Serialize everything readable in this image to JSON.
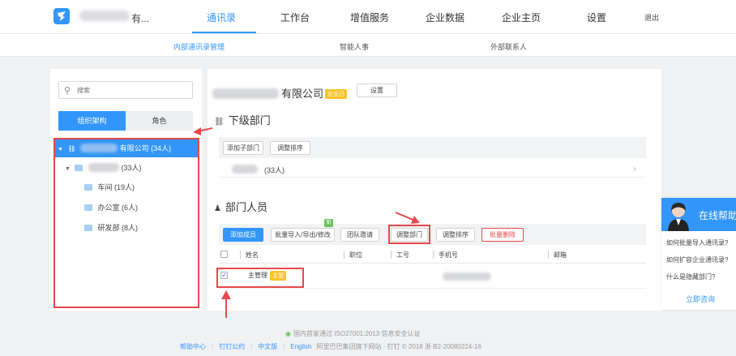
{
  "topnav": {
    "company_suffix": "有...",
    "items": [
      "通讯录",
      "工作台",
      "增值服务",
      "企业数据",
      "企业主页",
      "设置"
    ],
    "logout": "退出"
  },
  "subnav": {
    "items": [
      "内部通讯录管理",
      "智能人事",
      "外部联系人"
    ]
  },
  "sidebar": {
    "search_placeholder": "搜索",
    "tabs": [
      "组织架构",
      "角色"
    ],
    "tree": {
      "root_label": "有限公司 (34人)",
      "dept_count": "(33人)",
      "children": [
        "车间 (19人)",
        "办公室 (6人)",
        "研发部 (8人)"
      ]
    }
  },
  "main": {
    "org_name_suffix": "有限公司",
    "cert_badge": "企业已",
    "settings_button": "设置",
    "sub_dept_title": "下级部门",
    "add_sub_dept": "添加子部门",
    "adjust_order": "调整排序",
    "sub_dept_count": "(33人)",
    "members_title": "部门人员",
    "buttons": {
      "add_member": "添加成员",
      "batch_import": "批量导入/导出/修改",
      "new_badge": "新",
      "team_invite": "团队邀请",
      "adjust_dept": "调整部门",
      "adjust_order": "调整排序",
      "batch_delete": "批量删除"
    },
    "table_headers": [
      "姓名",
      "职位",
      "工号",
      "手机号",
      "邮箱"
    ],
    "rows": [
      {
        "name": "主管理",
        "badge": "主管"
      }
    ]
  },
  "help": {
    "title": "在线帮助",
    "questions": [
      "如何批量导入通讯录?",
      "如何扩容企业通讯录?",
      "什么是隐藏部门?"
    ],
    "consult": "立即咨询"
  },
  "footer": {
    "cert": "国内首家通过 ISO27001:2013 信息安全认证",
    "links": [
      "帮助中心",
      "钉钉公约",
      "中文版",
      "English"
    ],
    "copyright": "阿里巴巴集团旗下网站 · 钉钉 © 2018 浙 B2-20080224-16"
  }
}
